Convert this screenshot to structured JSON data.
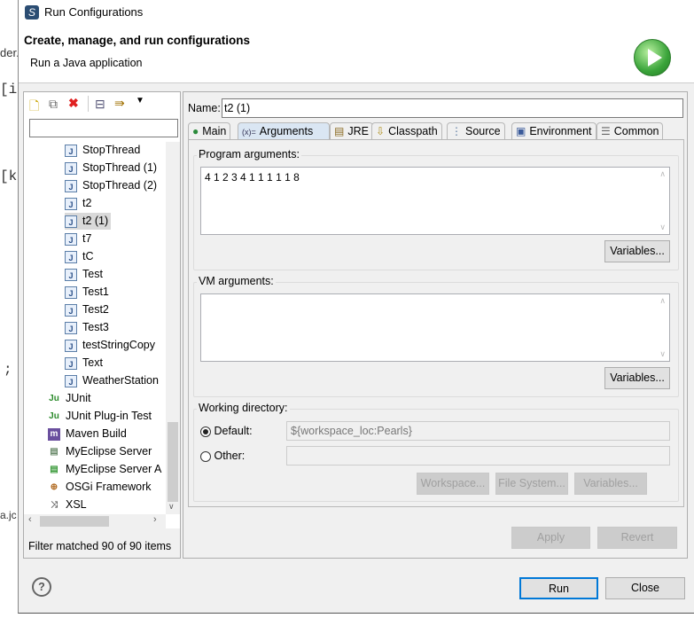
{
  "background_fragments": [
    "der.",
    "[i",
    "[k",
    ";",
    "a.jc"
  ],
  "window": {
    "title": "Run Configurations",
    "icon": "eclipse-icon"
  },
  "header": {
    "title": "Create, manage, and run configurations",
    "subtitle": "Run a Java application",
    "icon": "run-icon"
  },
  "toolbar": {
    "icons": [
      "new-configuration-icon",
      "duplicate-icon",
      "delete-icon",
      "collapse-all-icon",
      "filter-icon",
      "dropdown-icon"
    ]
  },
  "filter": {
    "value": "",
    "placeholder": ""
  },
  "tree": {
    "children": [
      "StopThread",
      "StopThread (1)",
      "StopThread (2)",
      "t2",
      "t2 (1)",
      "t7",
      "tC",
      "Test",
      "Test1",
      "Test2",
      "Test3",
      "testStringCopy",
      "Text",
      "WeatherStation"
    ],
    "selected": "t2 (1)",
    "categories": [
      {
        "label": "JUnit",
        "icon": "junit-icon"
      },
      {
        "label": "JUnit Plug-in Test",
        "icon": "junit-plugin-icon"
      },
      {
        "label": "Maven Build",
        "icon": "maven-icon"
      },
      {
        "label": "MyEclipse Server",
        "icon": "server-icon"
      },
      {
        "label": "MyEclipse Server A",
        "icon": "server-app-icon"
      },
      {
        "label": "OSGi Framework",
        "icon": "osgi-icon"
      },
      {
        "label": "XSL",
        "icon": "xsl-icon"
      }
    ]
  },
  "filter_status": "Filter matched 90 of 90 items",
  "name": {
    "label": "Name:",
    "value": "t2 (1)"
  },
  "tabs": [
    {
      "label": "Main",
      "icon": "main-icon"
    },
    {
      "label": "Arguments",
      "icon": "arguments-icon",
      "active": true
    },
    {
      "label": "JRE",
      "icon": "jre-icon"
    },
    {
      "label": "Classpath",
      "icon": "classpath-icon"
    },
    {
      "label": "Source",
      "icon": "source-icon"
    },
    {
      "label": "Environment",
      "icon": "environment-icon"
    },
    {
      "label": "Common",
      "icon": "common-icon"
    }
  ],
  "program_args": {
    "label": "Program arguments:",
    "value": "4 1 2 3 4 1 1 1 1 1 8",
    "variables": "Variables..."
  },
  "vm_args": {
    "label": "VM arguments:",
    "value": "",
    "variables": "Variables..."
  },
  "working_dir": {
    "label": "Working directory:",
    "default_label": "Default:",
    "default_value": "${workspace_loc:Pearls}",
    "other_label": "Other:",
    "other_value": "",
    "workspace": "Workspace...",
    "filesystem": "File System...",
    "variables": "Variables..."
  },
  "buttons": {
    "apply": "Apply",
    "revert": "Revert",
    "run": "Run",
    "close": "Close"
  },
  "colors": {
    "accent": "#0078d7",
    "run_green": "#3aa43a"
  }
}
